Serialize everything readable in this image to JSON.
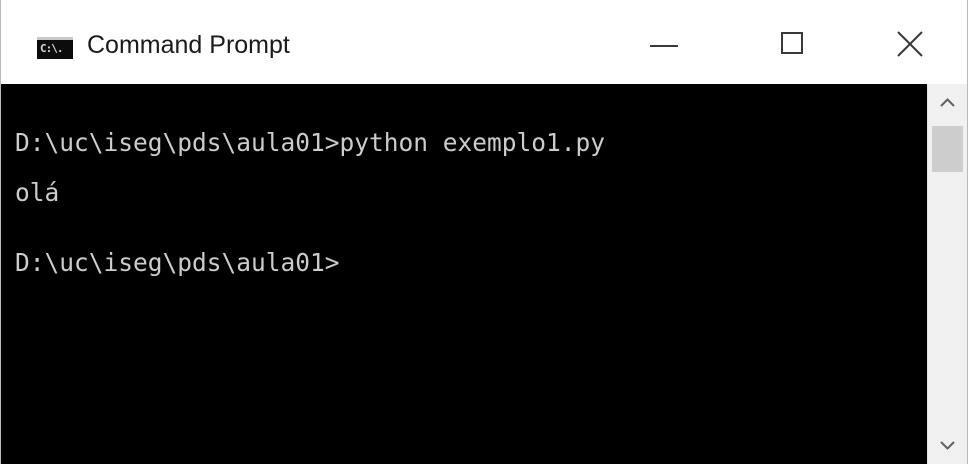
{
  "window": {
    "title": "Command Prompt",
    "icon_label": "C:\\."
  },
  "console": {
    "lines": [
      "D:\\uc\\iseg\\pds\\aula01>python exemplo1.py",
      "olá",
      "D:\\uc\\iseg\\pds\\aula01>"
    ]
  },
  "icons": {
    "minimize": "minimize-icon",
    "maximize": "maximize-icon",
    "close": "close-icon",
    "scroll_up": "chevron-up-icon",
    "scroll_down": "chevron-down-icon"
  },
  "colors": {
    "console_background": "#000000",
    "console_text": "#cccccc",
    "titlebar_background": "#ffffff",
    "scrollbar_track": "#f0f0f0",
    "scrollbar_thumb": "#cdcdcd"
  }
}
